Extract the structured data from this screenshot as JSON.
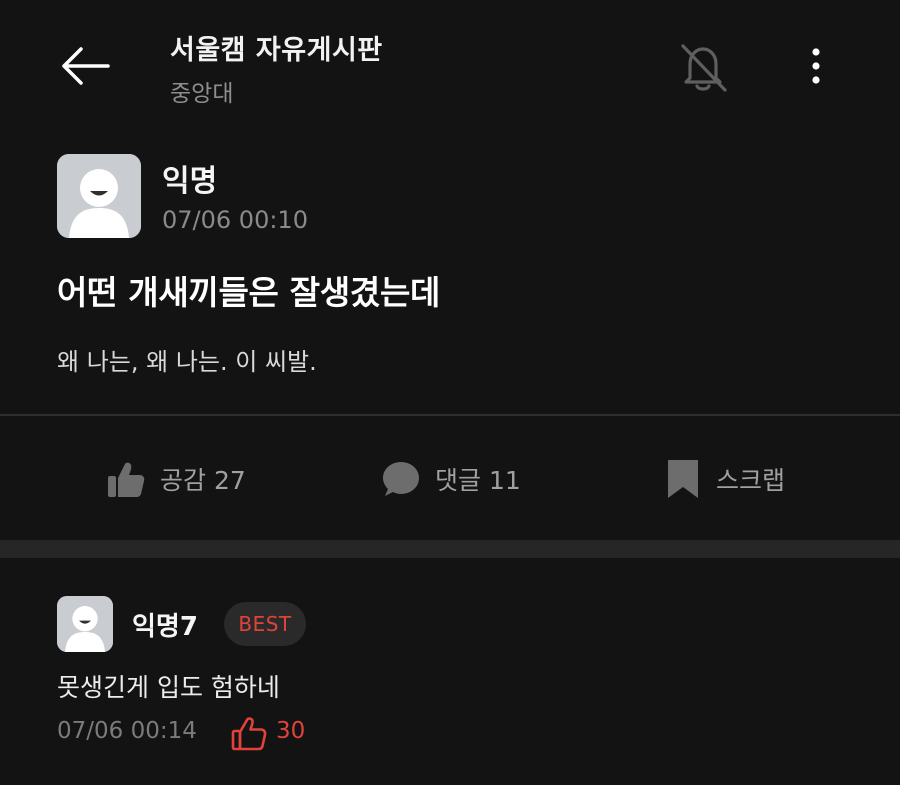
{
  "header": {
    "back_icon": "arrow-left-icon",
    "board_title": "서울캠 자유게시판",
    "school": "중앙대",
    "bell_icon": "bell-off-icon",
    "more_icon": "more-vertical-icon"
  },
  "post": {
    "author": "익명",
    "time": "07/06 00:10",
    "title": "어떤 개새끼들은 잘생겼는데",
    "body": "왜 나는, 왜 나는. 이 씨발."
  },
  "actions": {
    "like_label": "공감 27",
    "comment_label": "댓글 11",
    "scrap_label": "스크랩"
  },
  "comments": [
    {
      "author": "익명7",
      "badge": "BEST",
      "text": "못생긴게 입도 험하네",
      "time": "07/06 00:14",
      "likes": "30"
    }
  ],
  "colors": {
    "background": "#131313",
    "accent_red": "#e0433b",
    "muted": "#8a8a8a"
  }
}
